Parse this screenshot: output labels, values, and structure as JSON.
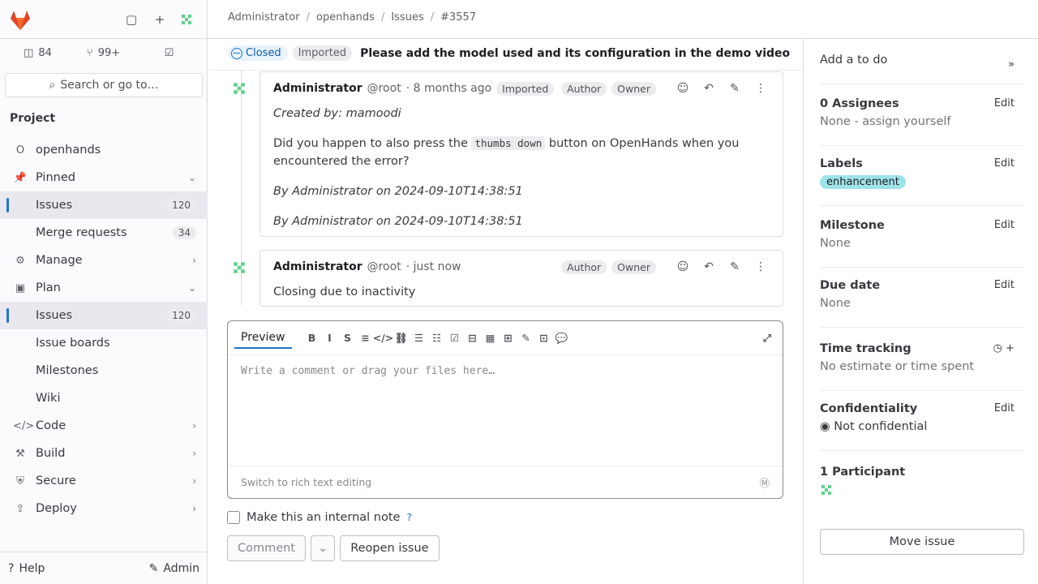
{
  "sidebar": {
    "counts": [
      {
        "icon": "issues-icon",
        "value": "84"
      },
      {
        "icon": "merge-request-icon",
        "value": "99+"
      },
      {
        "icon": "todo-icon",
        "value": ""
      }
    ],
    "search_label": "Search or go to…",
    "section_title": "Project",
    "items": [
      {
        "label": "openhands",
        "icon": "O",
        "badge": "",
        "chevron": ""
      },
      {
        "label": "Pinned",
        "icon": "📌",
        "badge": "",
        "chevron": "⌄"
      },
      {
        "label": "Issues",
        "icon": "",
        "badge": "120",
        "chevron": "",
        "active": true
      },
      {
        "label": "Merge requests",
        "icon": "",
        "badge": "34",
        "chevron": ""
      },
      {
        "label": "Manage",
        "icon": "⚙",
        "badge": "",
        "chevron": "›"
      },
      {
        "label": "Plan",
        "icon": "▣",
        "badge": "",
        "chevron": "⌄"
      },
      {
        "label": "Issues",
        "icon": "",
        "badge": "120",
        "chevron": "",
        "active": true
      },
      {
        "label": "Issue boards",
        "icon": "",
        "badge": "",
        "chevron": ""
      },
      {
        "label": "Milestones",
        "icon": "",
        "badge": "",
        "chevron": ""
      },
      {
        "label": "Wiki",
        "icon": "",
        "badge": "",
        "chevron": ""
      },
      {
        "label": "Code",
        "icon": "</>",
        "badge": "",
        "chevron": "›"
      },
      {
        "label": "Build",
        "icon": "⚒",
        "badge": "",
        "chevron": "›"
      },
      {
        "label": "Secure",
        "icon": "⛨",
        "badge": "",
        "chevron": "›"
      },
      {
        "label": "Deploy",
        "icon": "⇪",
        "badge": "",
        "chevron": "›"
      }
    ],
    "help": "Help",
    "admin": "Admin"
  },
  "breadcrumbs": [
    "Administrator",
    "openhands",
    "Issues",
    "#3557"
  ],
  "issue": {
    "status": "Closed",
    "imported": "Imported",
    "title": "Please add the model used and its configuration in the demo video"
  },
  "notes": [
    {
      "author": "Administrator",
      "handle": "@root",
      "time": "· 8 months ago",
      "imported": "Imported",
      "roles": [
        "Author",
        "Owner"
      ],
      "created_by": "Created by: mamoodi",
      "body_pre": "Did you happen to also press the ",
      "body_code": "thumbs down",
      "body_post": " button on OpenHands when you encountered the error?",
      "sig1": "By Administrator on 2024-09-10T14:38:51",
      "sig2": "By Administrator on 2024-09-10T14:38:51"
    },
    {
      "author": "Administrator",
      "handle": "@root",
      "time": "· just now",
      "roles": [
        "Author",
        "Owner"
      ],
      "body": "Closing due to inactivity"
    }
  ],
  "editor": {
    "tab": "Preview",
    "placeholder": "Write a comment or drag your files here…",
    "footer": "Switch to rich text editing",
    "toolbar": [
      "B",
      "I",
      "S",
      "≡",
      "</>",
      "⛓",
      "☰",
      "☷",
      "☑",
      "⊟",
      "▦",
      "⊞",
      "✎",
      "⊡",
      "💬"
    ]
  },
  "internal_note": "Make this an internal note",
  "buttons": {
    "comment": "Comment",
    "dropdown": "⌄",
    "reopen": "Reopen issue"
  },
  "right": {
    "todo": "Add a to do",
    "assignees_title": "0 Assignees",
    "assignees_val": "None - assign yourself",
    "labels_title": "Labels",
    "label": "enhancement",
    "milestone_title": "Milestone",
    "milestone_val": "None",
    "due_title": "Due date",
    "due_val": "None",
    "time_title": "Time tracking",
    "time_val": "No estimate or time spent",
    "conf_title": "Confidentiality",
    "conf_val": "Not confidential",
    "participants_title": "1 Participant",
    "edit": "Edit",
    "move": "Move issue"
  }
}
